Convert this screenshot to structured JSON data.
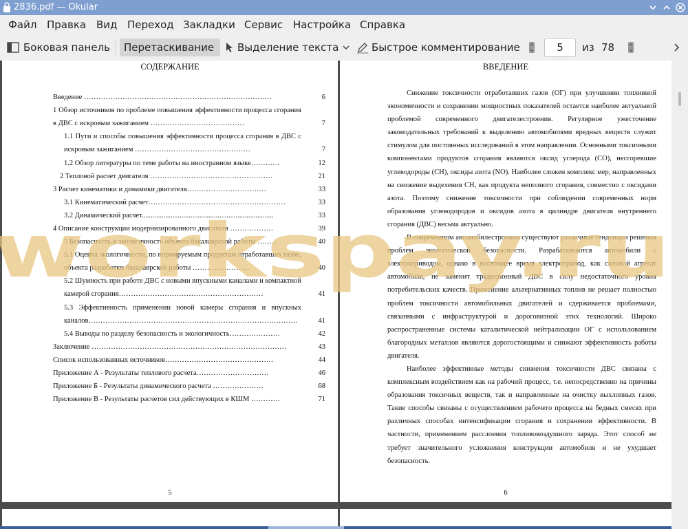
{
  "window": {
    "title": "2836.pdf — Okular"
  },
  "menu": [
    "Файл",
    "Правка",
    "Вид",
    "Переход",
    "Закладки",
    "Сервис",
    "Настройка",
    "Справка"
  ],
  "toolbar": {
    "sidebar": "Боковая панель",
    "drag": "Перетаскивание",
    "select_text": "Выделение текста",
    "quick_comment": "Быстрое комментирование",
    "page_current": "5",
    "of": "из",
    "page_total": "78"
  },
  "left_page": {
    "heading": "СОДЕРЖАНИЕ",
    "number": "5",
    "toc": [
      {
        "text": "Введение ……………………………………………………………………",
        "page": "6",
        "indent": 0,
        "lines": 1
      },
      {
        "text": "1 Обзор источников по проблеме повышения эффективности процесса сгорания в ДВС с искровым зажиганием …………………………………",
        "page": "7",
        "indent": 0,
        "lines": 2
      },
      {
        "text": "1.1 Пути и способы повышения эффективности процесса сгорания в ДВС с искровым зажиганием …………………………………………",
        "page": "7",
        "indent": 1,
        "lines": 2
      },
      {
        "text": "1.2 Обзор литературы по теме работы на иностранном языке…………",
        "page": "12",
        "indent": 1,
        "lines": 1
      },
      {
        "text": "2 Тепловой расчет двигателя ……………………………………………",
        "page": "21",
        "indent": 2,
        "lines": 1
      },
      {
        "text": "3 Расчет кинематики и динамики двигателя……………………………",
        "page": "33",
        "indent": 0,
        "lines": 1
      },
      {
        "text": "3.1 Кинематический расчет…………………………………………………",
        "page": "33",
        "indent": 1,
        "lines": 1
      },
      {
        "text": "3.2 Динамический расчет.........................................................................",
        "page": "33",
        "indent": 1,
        "lines": 1
      },
      {
        "text": "4 Описание конструкции модернизированного двигателя ………………",
        "page": "39",
        "indent": 0,
        "lines": 1
      },
      {
        "text": "5 Безопасность и экологичность объекта бакалаврской работы ………",
        "page": "40",
        "indent": 1,
        "lines": 1
      },
      {
        "text": "5.1 Оценка экологичности, по нормируемым продуктам отработавших газов, объекта разработки бакалаврской работы ……………………",
        "page": "40",
        "indent": 1,
        "lines": 2
      },
      {
        "text": "5.2 Шумность при работе ДВС с новыми впускными каналами и компактной камерой сгорания……………………………………………………",
        "page": "41",
        "indent": 1,
        "lines": 2
      },
      {
        "text": "5.3 Эффективность применении новой камеры сгорания и впускных каналов……………………………………………………………………………",
        "page": "41",
        "indent": 1,
        "lines": 2
      },
      {
        "text": "5.4 Выводы по разделу безопасность и экологичность…………………",
        "page": "42",
        "indent": 1,
        "lines": 1
      },
      {
        "text": "Заключение ………………………………………………………………………",
        "page": "43",
        "indent": 0,
        "lines": 1
      },
      {
        "text": "Список использованных источников………………………………………",
        "page": "44",
        "indent": 0,
        "lines": 1
      },
      {
        "text": "Приложение А - Результаты теплового расчета…………………………",
        "page": "46",
        "indent": 0,
        "lines": 1
      },
      {
        "text": "Приложение Б - Результаты динамического расчета …………………",
        "page": "68",
        "indent": 0,
        "lines": 1
      },
      {
        "text": "Приложение В - Результаты расчетов сил действующих в КШМ …………",
        "page": "71",
        "indent": 0,
        "lines": 1
      }
    ]
  },
  "right_page": {
    "heading": "ВВЕДЕНИЕ",
    "number": "6",
    "paragraphs": [
      "Снижение токсичности отработавших газов (ОГ) при улучшении топливной экономичности и сохранении мощностных показателей остается наиболее актуальной проблемой современного двигателестроения. Регулярное ужесточение законодательных требований к выделению автомобилями вредных веществ служит стимулом для постоянных исследований в этом направлении. Основными токсичными компонентами продуктов сгорания являются оксид углерода (CO), несгоревшие углеводороды (CH), оксиды азота (NO). Наиболее сложен комплекс мер, направленных на снижение выделения CH, как продукта неполного сгорания, совместно с оксидами азота. Поэтому снижение токсичности при соблюдении современных норм образования углеводородов и оксидов азота в цилиндре двигателя внутреннего сгорания (ДВС) весьма актуально.",
      "В современном автомобилестроении существуют различные тенденции решения проблем экологической безопасности. Разрабатываются автомобили с электроприводом, однако в настоящее время электропривод, как силовой агрегат автомобиля, не заменит традиционный ДВС в силу недостаточного уровня потребительских качеств. Применение альтернативных топлив не решает полностью проблем токсичности автомобильных двигателей и сдерживается проблемами, связанными с инфраструктурой и дороговизной этих технологий. Широко распространенные системы каталитической нейтрализации ОГ с использованием благородных металлов являются дорогостоящими и снижают эффективность работы двигателя.",
      "Наиболее эффективные методы снижения токсичности ДВС связаны с комплексным воздействием как на рабочий процесс, т.е. непосредственно на причины образования токсичных веществ, так и направленные на очистку выхлопных газов. Такие способы связаны с осуществлением рабочего процесса на бедных смесях при различных способах интенсификации сгорания и сохранении эффективности. В частности, применением расслоения топливовоздушного заряда. Этот способ не требует значительного усложнения конструкции автомобиля и не ухудшает безопасность."
    ]
  },
  "watermark": "workspay.ru",
  "colors": {
    "titlebar": "#7e9fd0",
    "chrome": "#efefef",
    "viewer_bg": "#4d4d4d",
    "watermark": "#e8c680"
  }
}
